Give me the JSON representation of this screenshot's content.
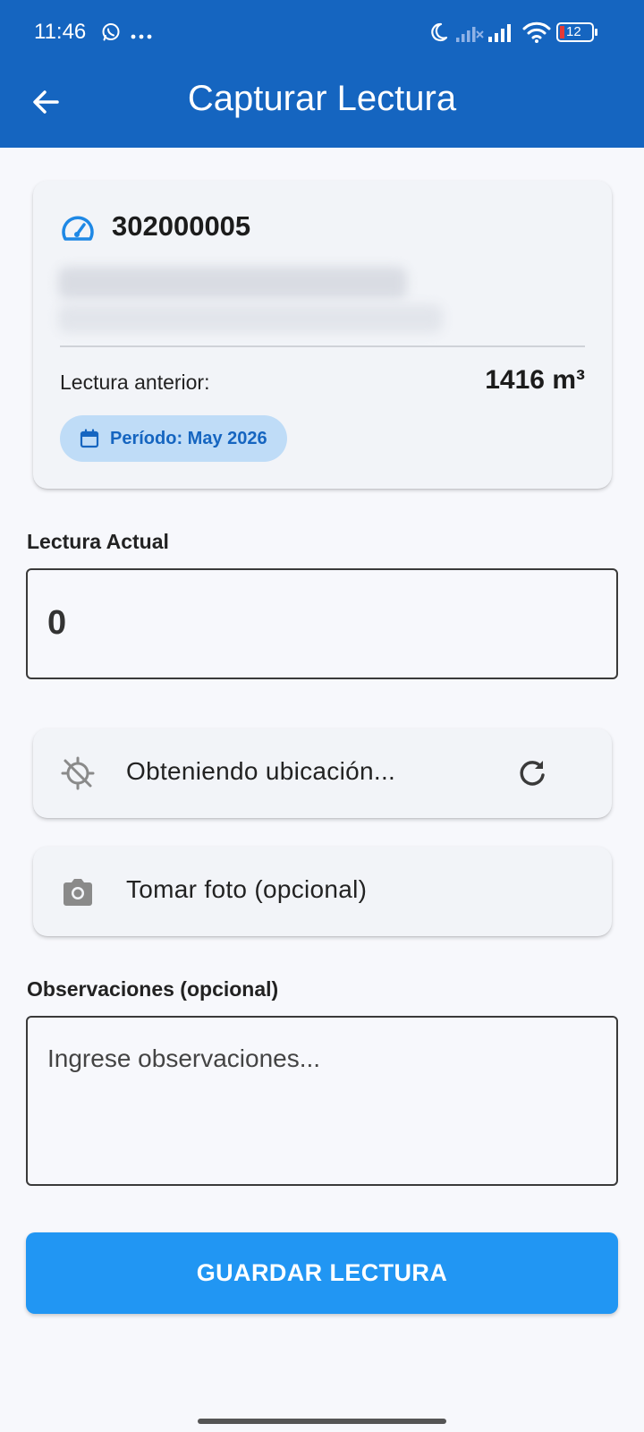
{
  "status_bar": {
    "time": "11:46",
    "battery": "12"
  },
  "toolbar": {
    "title": "Capturar Lectura"
  },
  "meter_card": {
    "meter_id": "302000005",
    "previous_reading_label": "Lectura anterior:",
    "previous_reading_value": "1416 m³",
    "period_label": "Período: May 2026"
  },
  "current_reading": {
    "label": "Lectura Actual",
    "value": "0"
  },
  "location_tile": {
    "label": "Obteniendo ubicación..."
  },
  "photo_tile": {
    "label": "Tomar foto (opcional)"
  },
  "observations": {
    "label": "Observaciones (opcional)",
    "placeholder": "Ingrese observaciones..."
  },
  "save_button": {
    "label": "GUARDAR LECTURA"
  },
  "colors": {
    "appbar": "#1565c0",
    "primary_button": "#2196f3",
    "chip_background": "#bfdcf7",
    "icon_blue": "#1e88e5",
    "icon_grey": "#8a8a8a"
  },
  "icons": {
    "back": "arrow-back-icon",
    "meter": "speedometer-icon",
    "period": "calendar-icon",
    "location": "location-off-icon",
    "refresh": "refresh-icon",
    "photo": "camera-icon"
  }
}
